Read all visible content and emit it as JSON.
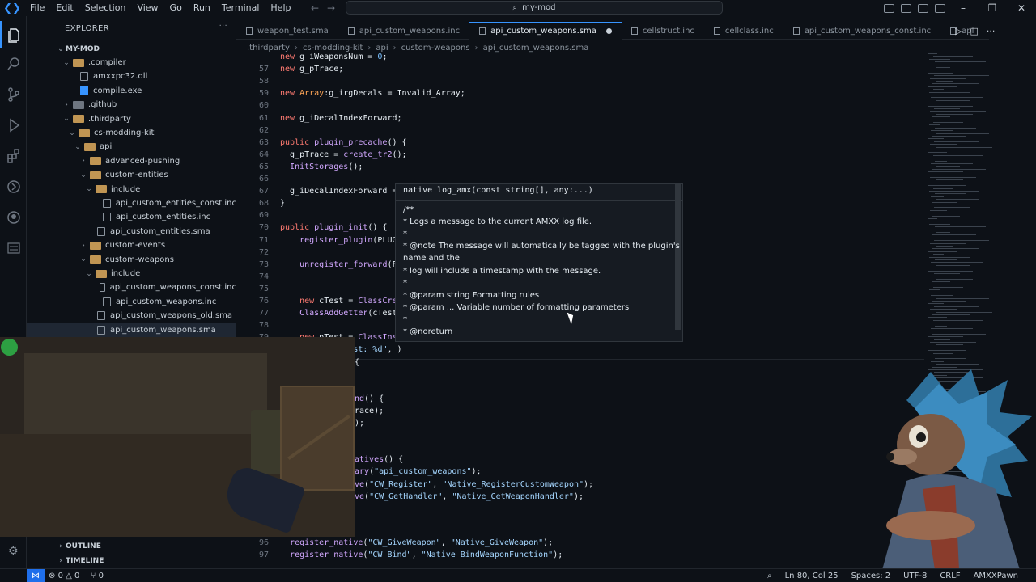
{
  "menu": [
    "File",
    "Edit",
    "Selection",
    "View",
    "Go",
    "Run",
    "Terminal",
    "Help"
  ],
  "title": "my-mod",
  "sidebar": {
    "header": "EXPLORER",
    "root": "MY-MOD",
    "items": [
      {
        "label": ".compiler",
        "kind": "folder",
        "indent": 1,
        "open": true
      },
      {
        "label": "amxxpc32.dll",
        "kind": "file",
        "indent": 2
      },
      {
        "label": "compile.exe",
        "kind": "exe",
        "indent": 2
      },
      {
        "label": ".github",
        "kind": "folder-gh",
        "indent": 1,
        "open": false
      },
      {
        "label": ".thirdparty",
        "kind": "folder",
        "indent": 1,
        "open": true
      },
      {
        "label": "cs-modding-kit",
        "kind": "folder",
        "indent": 2,
        "open": true
      },
      {
        "label": "api",
        "kind": "folder",
        "indent": 3,
        "open": true
      },
      {
        "label": "advanced-pushing",
        "kind": "folder",
        "indent": 4,
        "open": false
      },
      {
        "label": "custom-entities",
        "kind": "folder",
        "indent": 4,
        "open": true
      },
      {
        "label": "include",
        "kind": "folder",
        "indent": 5,
        "open": true
      },
      {
        "label": "api_custom_entities_const.inc",
        "kind": "file",
        "indent": 6
      },
      {
        "label": "api_custom_entities.inc",
        "kind": "file",
        "indent": 6
      },
      {
        "label": "api_custom_entities.sma",
        "kind": "file",
        "indent": 5
      },
      {
        "label": "custom-events",
        "kind": "folder",
        "indent": 4,
        "open": false
      },
      {
        "label": "custom-weapons",
        "kind": "folder",
        "indent": 4,
        "open": true
      },
      {
        "label": "include",
        "kind": "folder",
        "indent": 5,
        "open": true
      },
      {
        "label": "api_custom_weapons_const.inc",
        "kind": "file",
        "indent": 6
      },
      {
        "label": "api_custom_weapons.inc",
        "kind": "file",
        "indent": 6
      },
      {
        "label": "api_custom_weapons_old.sma",
        "kind": "file",
        "indent": 5
      },
      {
        "label": "api_custom_weapons.sma",
        "kind": "file",
        "indent": 5,
        "selected": true
      }
    ],
    "panels": [
      "OUTLINE",
      "TIMELINE"
    ]
  },
  "tabs": [
    {
      "label": "weapon_test.sma",
      "active": false
    },
    {
      "label": "api_custom_weapons.inc",
      "active": false
    },
    {
      "label": "api_custom_weapons.sma",
      "active": true,
      "dirty": true
    },
    {
      "label": "cellstruct.inc",
      "active": false
    },
    {
      "label": "cellclass.inc",
      "active": false
    },
    {
      "label": "api_custom_weapons_const.inc",
      "active": false
    },
    {
      "label": "api",
      "active": false
    }
  ],
  "breadcrumb": [
    ".thirdparty",
    "cs-modding-kit",
    "api",
    "custom-weapons",
    "api_custom_weapons.sma"
  ],
  "code_lines": [
    {
      "n": "",
      "html": "new g_iWeaponsNum = 0;"
    },
    {
      "n": "57",
      "html": "new g_pTrace;"
    },
    {
      "n": "58",
      "html": ""
    },
    {
      "n": "59",
      "html": "new Array:g_irgDecals = Invalid_Array;"
    },
    {
      "n": "60",
      "html": ""
    },
    {
      "n": "61",
      "html": "new g_iDecalIndexForward;"
    },
    {
      "n": "62",
      "html": ""
    },
    {
      "n": "63",
      "html": "public plugin_precache() {"
    },
    {
      "n": "64",
      "html": "  g_pTrace = create_tr2();"
    },
    {
      "n": "65",
      "html": "  InitStorages();"
    },
    {
      "n": "66",
      "html": ""
    },
    {
      "n": "67",
      "html": "  g_iDecalIndexForward = register_forward(FM_DecalIndex, \"OnDecalIndex\", 1);"
    },
    {
      "n": "68",
      "html": "}"
    },
    {
      "n": "69",
      "html": ""
    },
    {
      "n": "70",
      "html": "public plugin_init() {"
    },
    {
      "n": "71",
      "html": "    register_plugin(PLUGIN, VERSION, AUTHOR);"
    },
    {
      "n": "72",
      "html": ""
    },
    {
      "n": "73",
      "html": "    unregister_forward(FM_DecalIndex, g_iDecalIndexForward, 1);"
    },
    {
      "n": "74",
      "html": ""
    },
    {
      "n": "75",
      "html": ""
    },
    {
      "n": "76",
      "html": "    new cTest = ClassCreate();"
    },
    {
      "n": "77",
      "html": "    ClassAddGetter(cTest, \"Test\");"
    },
    {
      "n": "78",
      "html": ""
    },
    {
      "n": "79",
      "html": "    new pTest = ClassInstanceCreate(cTest);"
    },
    {
      "n": "80",
      "html": "    log_amx(\"Test: %d\", )"
    }
  ],
  "code_lines_lower": [
    {
      "n": "96",
      "html": "  register_native(\"CW_GiveWeapon\", \"Native_GiveWeapon\");"
    },
    {
      "n": "97",
      "html": "  register_native(\"CW_Bind\", \"Native_BindWeaponFunction\");"
    }
  ],
  "visible_fragments": [
    {
      "text": "{",
      "line": 81
    },
    {
      "text": "nd() {",
      "line": 84
    },
    {
      "text": "race);",
      "line": 85
    },
    {
      "text": ");",
      "line": 86
    },
    {
      "text": "atives() {",
      "line": 89
    },
    {
      "text": "ary(\"api_custom_weapons\");",
      "line": 90
    },
    {
      "text": "ve(\"CW_Register\", \"Native_RegisterCustomWeapon\");",
      "line": 91
    },
    {
      "text": "ve(\"CW_GetHandler\", \"Native_GetWeaponHandler\");",
      "line": 92
    }
  ],
  "hover": {
    "signature": "native log_amx(const string[], any:...)",
    "lines": [
      "/**",
      "* Logs a message to the current AMXX log file.",
      "*",
      "* @note The message will automatically be tagged with the plugin's",
      "name and the",
      "*       log will include a timestamp with the message.",
      "*",
      "* @param string    Formatting rules",
      "* @param ...       Variable number of formatting parameters",
      "*",
      "* @noreturn"
    ]
  },
  "statusbar": {
    "errors": "0",
    "warnings": "0",
    "ports": "0",
    "position": "Ln 80, Col 25",
    "spaces": "Spaces: 2",
    "encoding": "UTF-8",
    "eol": "CRLF",
    "language": "AMXXPawn"
  },
  "colors": {
    "accent": "#3794ff",
    "background": "#0d1117",
    "folder": "#c09553"
  }
}
